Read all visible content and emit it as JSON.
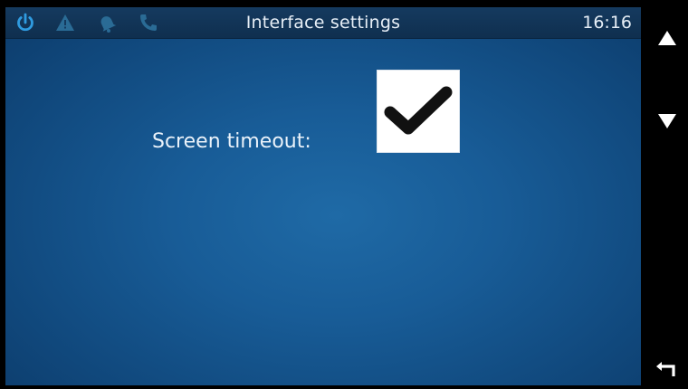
{
  "status_bar": {
    "title": "Interface settings",
    "time": "16:16",
    "icons": [
      "power-icon",
      "warning-icon",
      "bell-icon",
      "phone-icon"
    ],
    "active_icon_color": "#2f9be0",
    "inactive_icon_color": "#2a6b95"
  },
  "settings": {
    "screen_timeout_label": "Screen timeout:",
    "screen_timeout_checked": true
  },
  "side_buttons": [
    "arrow-up-icon",
    "arrow-down-icon",
    "back-icon"
  ]
}
